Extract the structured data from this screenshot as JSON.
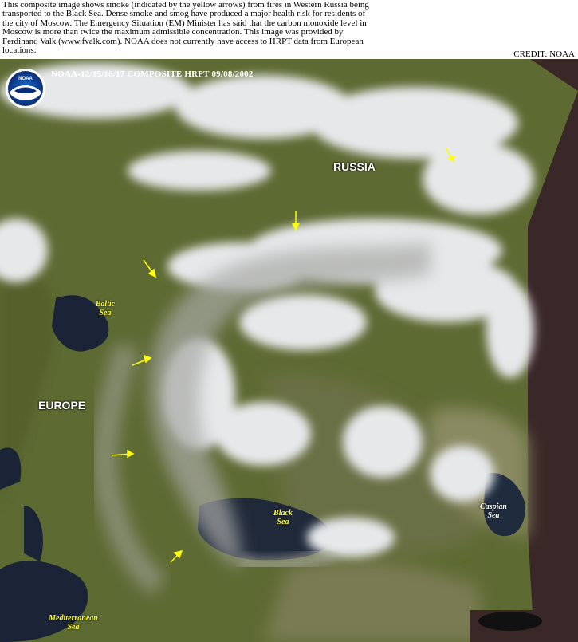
{
  "caption": "This composite image shows smoke (indicated by the yellow arrows) from fires in Western Russia being transported to the Black Sea.  Dense smoke and smog have produced a major health risk for residents of the city of Moscow.  The Emergency Situation (EM) Minister has said that the carbon monoxide level in Moscow is more than twice the maximum admissible concentration.  This image was provided by Ferdinand Valk (www.fvalk.com).  NOAA does not currently have access to HRPT data from European locations.",
  "credit": "CREDIT: NOAA",
  "logo_text": "NOAA",
  "image_title": "NOAA-12/15/16/17  COMPOSITE HRPT  09/08/2002",
  "labels": {
    "russia": "RUSSIA",
    "europe": "EUROPE",
    "baltic_line1": "Baltic",
    "baltic_line2": "Sea",
    "black_line1": "Black",
    "black_line2": "Sea",
    "caspian_line1": "Caspian",
    "caspian_line2": "Sea",
    "mediterranean_line1": "Mediterranean",
    "mediterranean_line2": "Sea"
  },
  "colors": {
    "arrow": "#ffff00",
    "background_dark": "#3a2727",
    "land": "#6f7a38",
    "water": "#1b2436",
    "cloud": "#e6e8ea",
    "smoke": "#a8a9a6"
  }
}
